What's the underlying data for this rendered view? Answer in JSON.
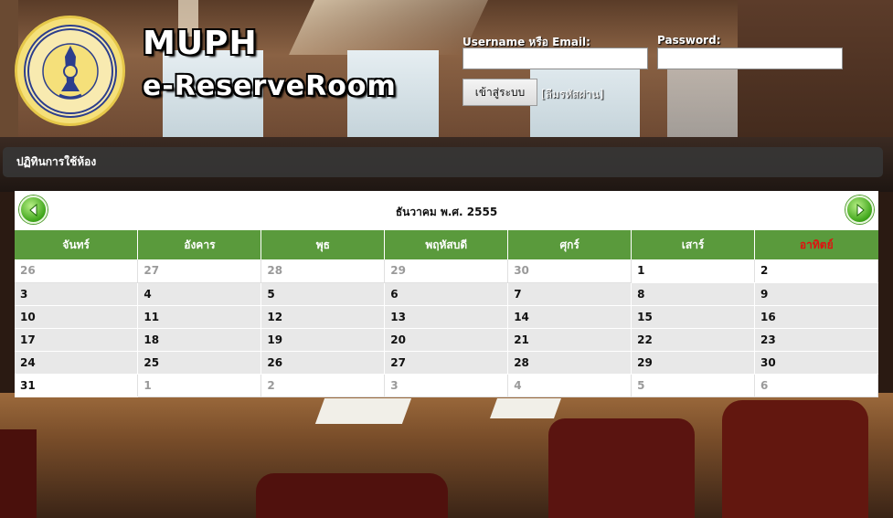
{
  "brand": {
    "line1": "MUPH",
    "line2": "e-ReserveRoom"
  },
  "logo": {
    "icon": "mahidol-university-seal-icon",
    "text": "มหาวิทยาลัยมหิดล"
  },
  "login": {
    "username_label": "Username หรือ Email:",
    "username_value": "",
    "password_label": "Password:",
    "password_value": "",
    "login_button": "เข้าสู่ระบบ",
    "forgot_link": "[ลืมรหัสผ่าน]"
  },
  "menu": {
    "title": "ปฏิทินการใช้ห้อง"
  },
  "calendar": {
    "month_title": "ธันวาคม  พ.ศ. 2555",
    "prev_icon": "left-arrow-icon",
    "next_icon": "right-arrow-icon",
    "weekdays": [
      "จันทร์",
      "อังคาร",
      "พุธ",
      "พฤหัสบดี",
      "ศุกร์",
      "เสาร์",
      "อาทิตย์"
    ],
    "weeks": [
      [
        {
          "d": "26",
          "o": true
        },
        {
          "d": "27",
          "o": true
        },
        {
          "d": "28",
          "o": true
        },
        {
          "d": "29",
          "o": true
        },
        {
          "d": "30",
          "o": true
        },
        {
          "d": "1",
          "o": false
        },
        {
          "d": "2",
          "o": false
        }
      ],
      [
        {
          "d": "3",
          "o": false
        },
        {
          "d": "4",
          "o": false
        },
        {
          "d": "5",
          "o": false
        },
        {
          "d": "6",
          "o": false
        },
        {
          "d": "7",
          "o": false
        },
        {
          "d": "8",
          "o": false
        },
        {
          "d": "9",
          "o": false
        }
      ],
      [
        {
          "d": "10",
          "o": false
        },
        {
          "d": "11",
          "o": false
        },
        {
          "d": "12",
          "o": false
        },
        {
          "d": "13",
          "o": false
        },
        {
          "d": "14",
          "o": false
        },
        {
          "d": "15",
          "o": false
        },
        {
          "d": "16",
          "o": false
        }
      ],
      [
        {
          "d": "17",
          "o": false
        },
        {
          "d": "18",
          "o": false
        },
        {
          "d": "19",
          "o": false
        },
        {
          "d": "20",
          "o": false
        },
        {
          "d": "21",
          "o": false
        },
        {
          "d": "22",
          "o": false
        },
        {
          "d": "23",
          "o": false
        }
      ],
      [
        {
          "d": "24",
          "o": false
        },
        {
          "d": "25",
          "o": false
        },
        {
          "d": "26",
          "o": false
        },
        {
          "d": "27",
          "o": false
        },
        {
          "d": "28",
          "o": false
        },
        {
          "d": "29",
          "o": false
        },
        {
          "d": "30",
          "o": false
        }
      ],
      [
        {
          "d": "31",
          "o": false
        },
        {
          "d": "1",
          "o": true
        },
        {
          "d": "2",
          "o": true
        },
        {
          "d": "3",
          "o": true
        },
        {
          "d": "4",
          "o": true
        },
        {
          "d": "5",
          "o": true
        },
        {
          "d": "6",
          "o": true
        }
      ]
    ]
  },
  "colors": {
    "header_green": "#5a9a3c",
    "sunday_red": "#e01010",
    "menubar": "#373737"
  }
}
